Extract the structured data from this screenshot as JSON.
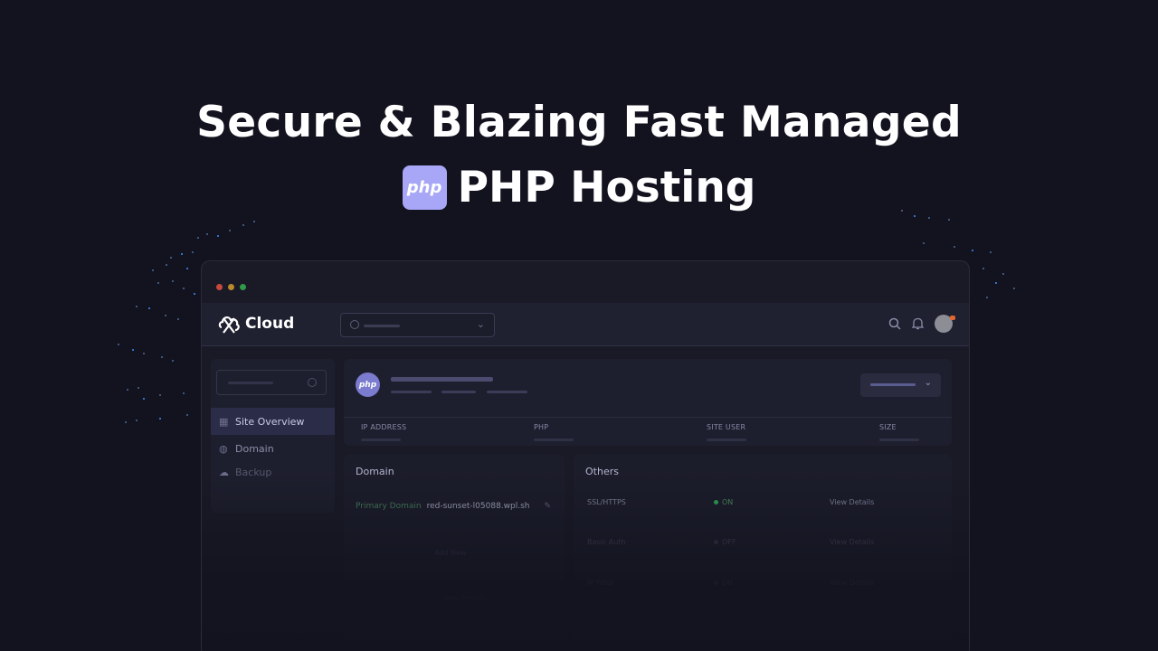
{
  "hero": {
    "line1": "Secure & Blazing Fast Managed",
    "badge": "php",
    "line2": "PHP Hosting"
  },
  "app": {
    "brand": "Cloud",
    "traffic_colors": [
      "#ff5f57",
      "#febc2e",
      "#28c840"
    ]
  },
  "sidebar": {
    "items": [
      {
        "label": "Site Overview",
        "icon": "grid-icon",
        "active": true
      },
      {
        "label": "Domain",
        "icon": "globe-icon",
        "active": false
      },
      {
        "label": "Backup",
        "icon": "cloud-icon",
        "active": false
      }
    ]
  },
  "site_header": {
    "badge": "php",
    "columns": [
      "IP ADDRESS",
      "PHP",
      "SITE USER",
      "SIZE"
    ]
  },
  "domain_panel": {
    "title": "Domain",
    "primary_label": "Primary Domain",
    "primary_value": "red-sunset-l05088.wpl.sh",
    "add_label": "Add New",
    "link_label": "View Details"
  },
  "others_panel": {
    "title": "Others",
    "rows": [
      {
        "name": "SSL/HTTPS",
        "status": "ON",
        "link": "View Details"
      },
      {
        "name": "Basic Auth",
        "status": "OFF",
        "link": "View Details"
      },
      {
        "name": "IP Filter",
        "status": "ON",
        "link": "View Details"
      }
    ]
  }
}
